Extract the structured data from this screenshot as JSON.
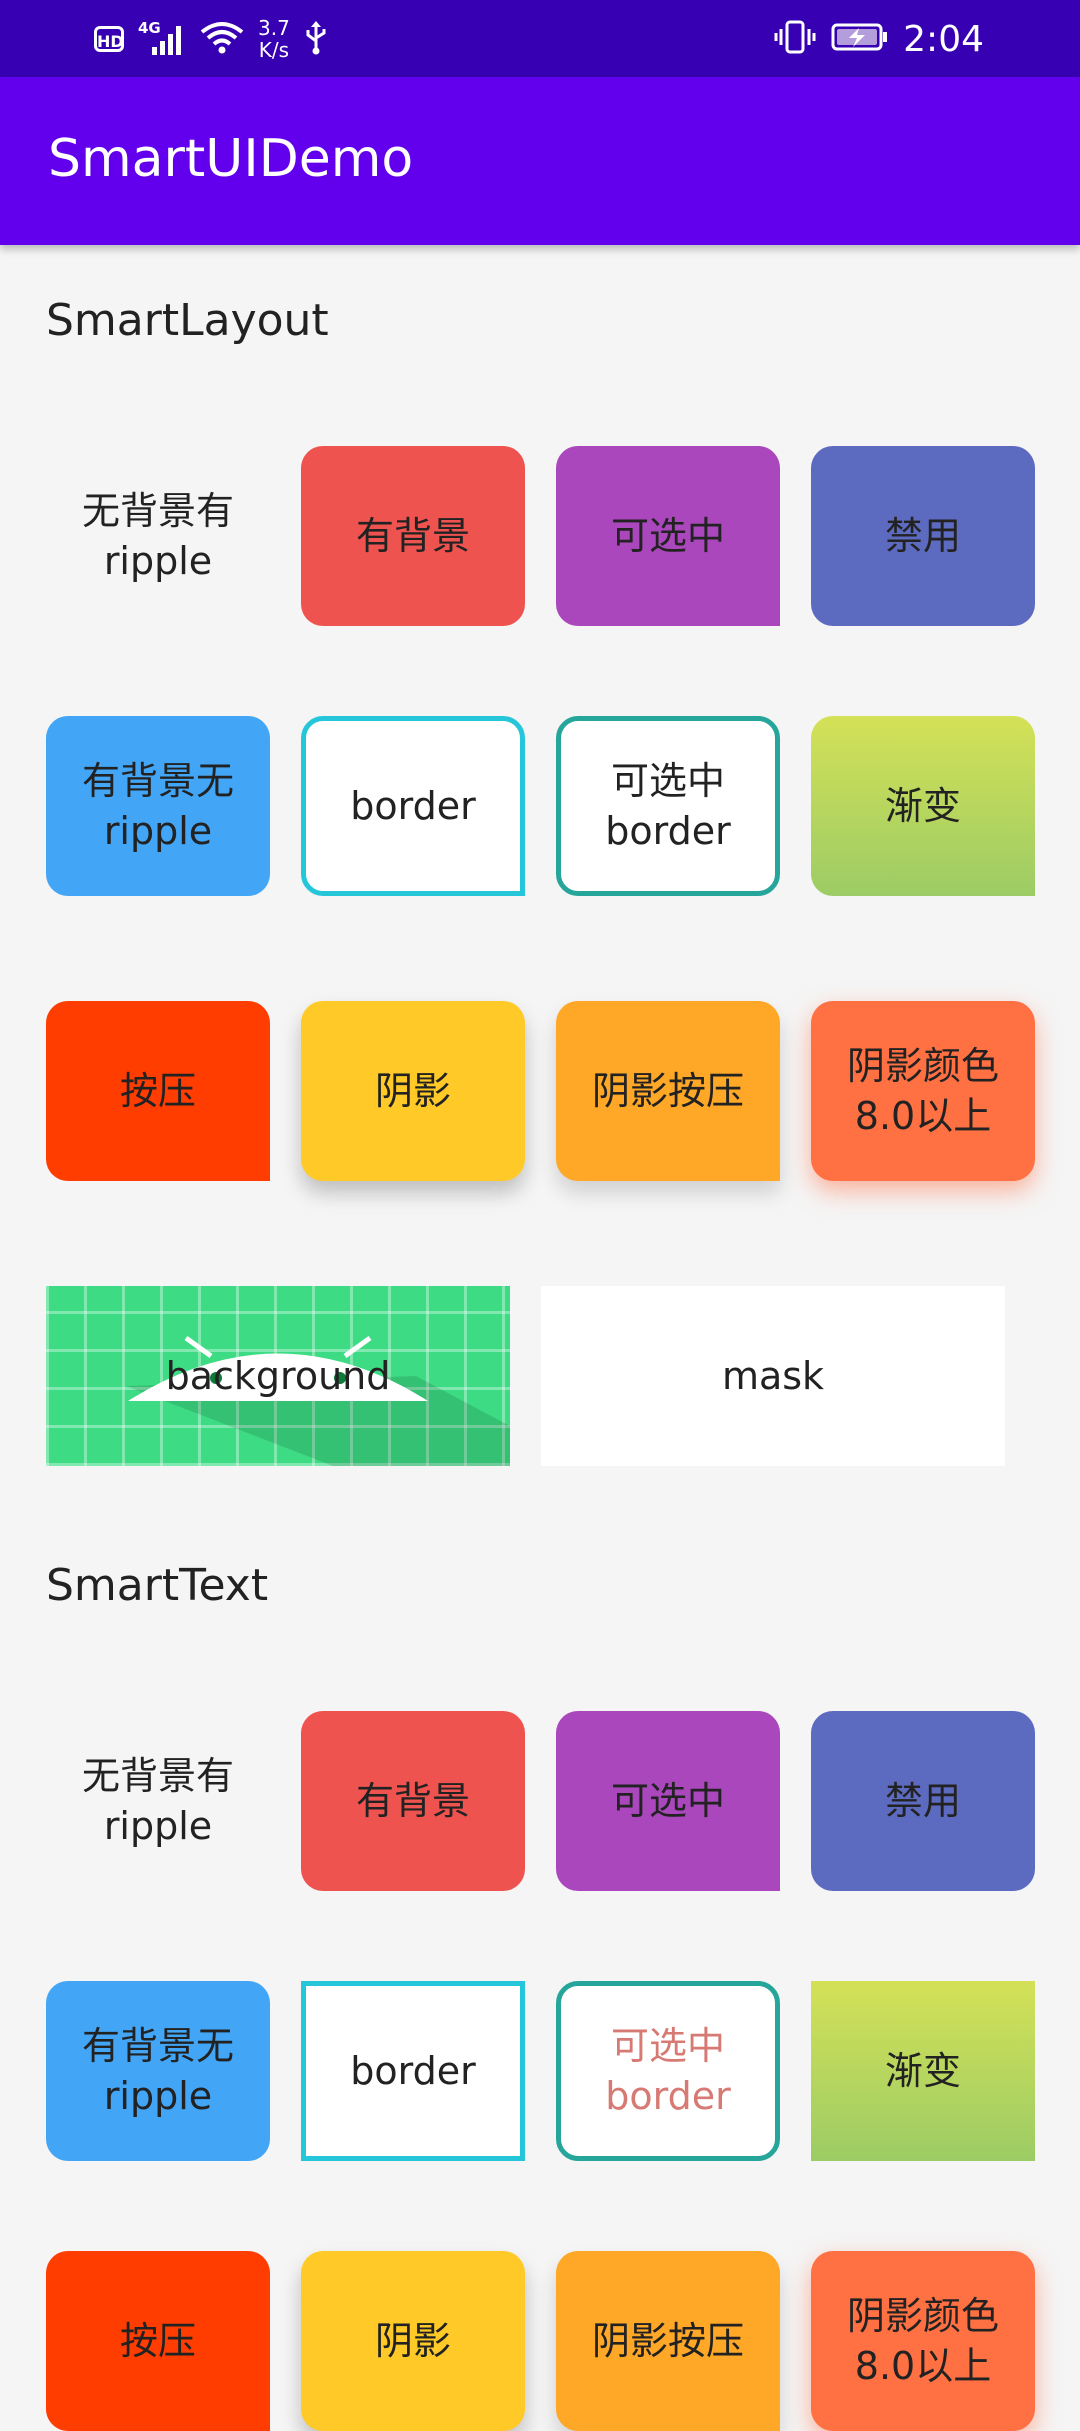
{
  "status_bar": {
    "hd": "HD",
    "network": "4G",
    "speed_value": "3.7",
    "speed_unit": "K/s",
    "time": "2:04"
  },
  "app_bar": {
    "title": "SmartUIDemo"
  },
  "sections": {
    "smart_layout": {
      "title": "SmartLayout",
      "row1": [
        "无背景有ripple",
        "有背景",
        "可选中",
        "禁用"
      ],
      "row2": [
        "有背景无ripple",
        "border",
        "可选中border",
        "渐变"
      ],
      "row3": [
        "按压",
        "阴影",
        "阴影按压",
        "阴影颜色8.0以上"
      ],
      "row4": [
        "background",
        "mask"
      ]
    },
    "smart_text": {
      "title": "SmartText",
      "row1": [
        "无背景有ripple",
        "有背景",
        "可选中",
        "禁用"
      ],
      "row2": [
        "有背景无ripple",
        "border",
        "可选中border",
        "渐变"
      ],
      "row3": [
        "按压",
        "阴影",
        "阴影按压",
        "阴影颜色8.0以上"
      ]
    }
  },
  "colors": {
    "status_bar": "#3700b3",
    "app_bar": "#6200ee",
    "red": "#ef5350",
    "purple": "#ab47bc",
    "indigo": "#5c6bc0",
    "blue": "#42a5f5",
    "cyan_border": "#26c6da",
    "teal_border": "#26a69a",
    "gradient_top": "#d4e157",
    "gradient_bottom": "#9ccc65",
    "orange_red": "#ff3d00",
    "amber": "#ffca28",
    "orange": "#ffa726",
    "deep_orange": "#ff7043",
    "android_green": "#3ddc84",
    "selected_text": "#d77a74"
  },
  "icons": [
    "hd-icon",
    "signal-icon",
    "wifi-icon",
    "usb-icon",
    "vibrate-icon",
    "battery-charging-icon",
    "android-logo"
  ]
}
